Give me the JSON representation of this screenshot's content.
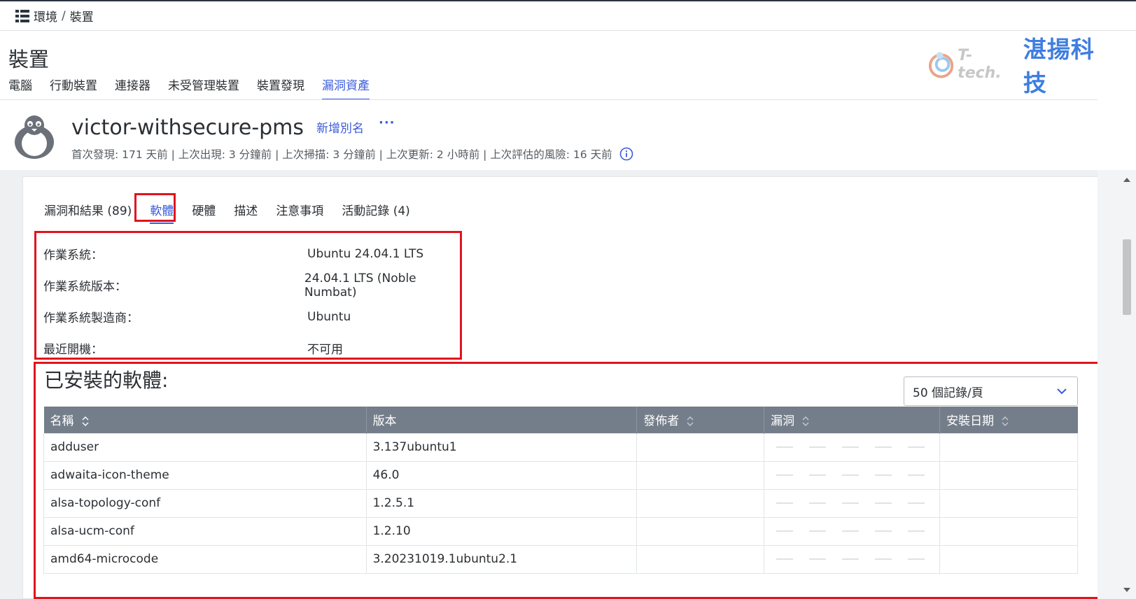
{
  "breadcrumb": {
    "root": "環境",
    "separator": "/",
    "current": "裝置"
  },
  "page_title": "裝置",
  "nav_tabs": [
    {
      "label": "電腦",
      "active": false
    },
    {
      "label": "行動裝置",
      "active": false
    },
    {
      "label": "連接器",
      "active": false
    },
    {
      "label": "未受管理裝置",
      "active": false
    },
    {
      "label": "裝置發現",
      "active": false
    },
    {
      "label": "漏洞資產",
      "active": true
    }
  ],
  "logo": {
    "latin": "T-tech.",
    "chinese": "湛揚科技"
  },
  "device": {
    "name": "victor-withsecure-pms",
    "add_alias": "新增別名",
    "more": "···",
    "meta": "首次發現: 171 天前 | 上次出現: 3 分鐘前 | 上次掃描: 3 分鐘前 | 上次更新: 2 小時前 | 上次評估的風險: 16 天前"
  },
  "sub_tabs": [
    {
      "label": "漏洞和結果 (89)",
      "active": false
    },
    {
      "label": "軟體",
      "active": true
    },
    {
      "label": "硬體",
      "active": false
    },
    {
      "label": "描述",
      "active": false
    },
    {
      "label": "注意事項",
      "active": false
    },
    {
      "label": "活動記錄 (4)",
      "active": false
    }
  ],
  "os_info": [
    {
      "label": "作業系統：",
      "value": "Ubuntu 24.04.1 LTS"
    },
    {
      "label": "作業系統版本：",
      "value": "24.04.1 LTS (Noble Numbat)"
    },
    {
      "label": "作業系統製造商：",
      "value": "Ubuntu"
    },
    {
      "label": "最近開機：",
      "value": "不可用"
    }
  ],
  "installed": {
    "title": "已安裝的軟體:",
    "page_size": "50 個記錄/頁",
    "columns": [
      "名稱",
      "版本",
      "發佈者",
      "漏洞",
      "安裝日期"
    ],
    "rows": [
      {
        "name": "adduser",
        "version": "3.137ubuntu1",
        "publisher": "",
        "installed": ""
      },
      {
        "name": "adwaita-icon-theme",
        "version": "46.0",
        "publisher": "",
        "installed": ""
      },
      {
        "name": "alsa-topology-conf",
        "version": "1.2.5.1",
        "publisher": "",
        "installed": ""
      },
      {
        "name": "alsa-ucm-conf",
        "version": "1.2.10",
        "publisher": "",
        "installed": ""
      },
      {
        "name": "amd64-microcode",
        "version": "3.20231019.1ubuntu2.1",
        "publisher": "",
        "installed": ""
      }
    ]
  },
  "colors": {
    "accent": "#3b5bdb",
    "header_bg": "#747e8a",
    "highlight": "#e0141e"
  }
}
